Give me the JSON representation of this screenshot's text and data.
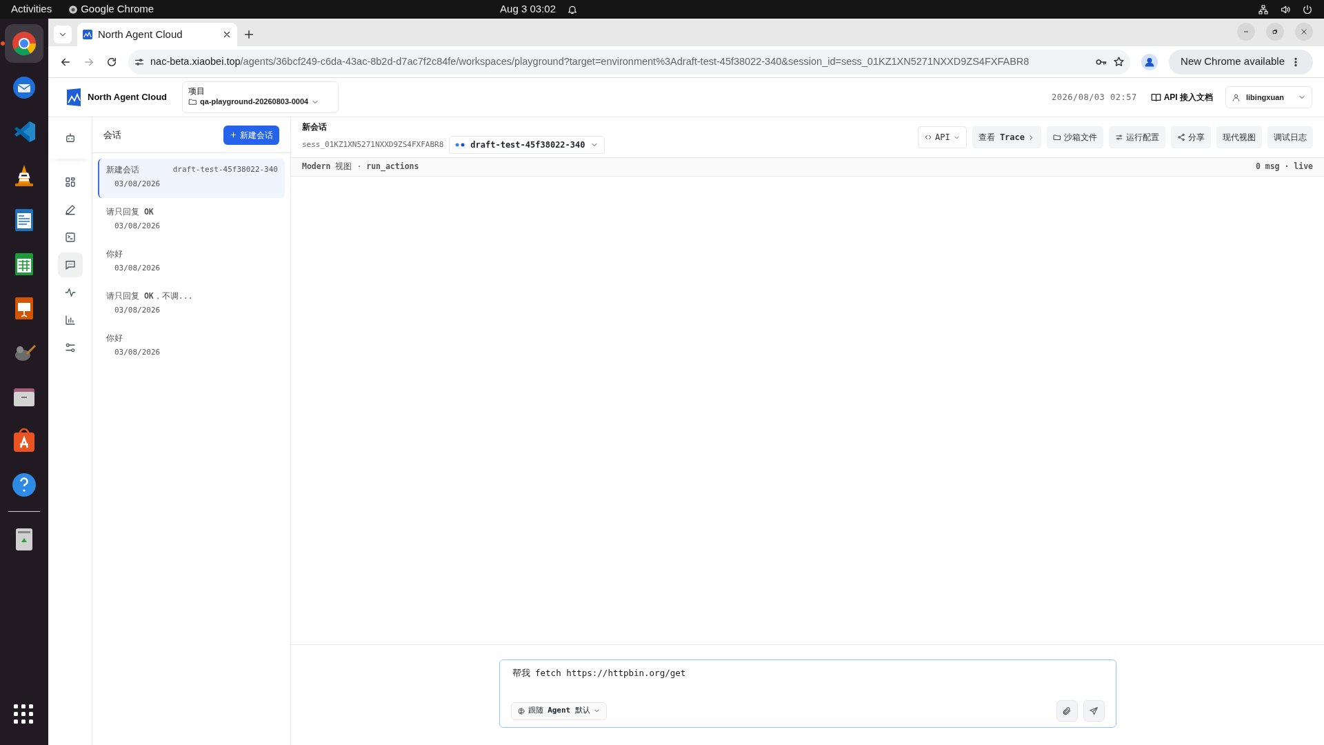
{
  "system_bar": {
    "activities": "Activities",
    "app": "Google Chrome",
    "clock": "Aug 3  03:02"
  },
  "dock": [
    {
      "kind": "chrome",
      "selected": true
    },
    {
      "kind": "mail",
      "selected": false
    },
    {
      "kind": "code",
      "selected": false
    },
    {
      "kind": "cone",
      "selected": false
    },
    {
      "kind": "writer",
      "selected": false
    },
    {
      "kind": "calc",
      "selected": false
    },
    {
      "kind": "impress",
      "selected": false
    },
    {
      "kind": "paint",
      "selected": false
    },
    {
      "kind": "files",
      "selected": false
    },
    {
      "kind": "store",
      "selected": false
    },
    {
      "kind": "help",
      "selected": false
    },
    {
      "kind": "trash",
      "selected": false
    }
  ],
  "browser": {
    "tab_title": "North Agent Cloud",
    "url_host": "nac-beta.xiaobei.top",
    "url_path": "/agents/36bcf249-c6da-43ac-8b2d-d7ac7f2c84fe/workspaces/playground?target=environment%3Adraft-test-45f38022-340&session_id=sess_01KZ1XN5271NXXD9ZS4FXFABR8",
    "update_button": "New Chrome available"
  },
  "header": {
    "brand": "North Agent Cloud",
    "project_label": "项目",
    "project": "qa-playground-20260803-0004",
    "datetime": "2026/08/03 02:57",
    "docs_link": "API 接入文档",
    "user": "libingxuan"
  },
  "rail": [
    {
      "kind": "robot",
      "selected": false
    },
    {
      "kind": "grid",
      "selected": false
    },
    {
      "kind": "pen",
      "selected": false
    },
    {
      "kind": "terminal",
      "selected": false
    },
    {
      "kind": "chat",
      "selected": true
    },
    {
      "kind": "pulse",
      "selected": false
    },
    {
      "kind": "chart",
      "selected": false
    },
    {
      "kind": "sliders",
      "selected": false
    }
  ],
  "sessions": {
    "title": "会话",
    "new_button": "新建会话",
    "items": [
      {
        "title": "新建会话",
        "tag": "draft-test-45f38022-340",
        "date": "03/08/2026",
        "selected": true
      },
      {
        "title": "请只回复 **OK**",
        "date": "03/08/2026",
        "selected": false
      },
      {
        "title": "你好",
        "date": "03/08/2026",
        "selected": false
      },
      {
        "title": "请只回复 **OK**，不调...",
        "date": "03/08/2026",
        "selected": false
      },
      {
        "title": "你好",
        "date": "03/08/2026",
        "selected": false
      }
    ]
  },
  "main": {
    "title": "新会话",
    "session_id": "sess_01KZ1XN5271NXXD9ZS4FXFABR8",
    "environment": "draft-test-45f38022-340",
    "toolbar": [
      {
        "label": "API",
        "kind": "dropdown"
      },
      {
        "label": "查看 **Trace**",
        "kind": "link"
      },
      {
        "label": "沙箱文件",
        "kind": "plain"
      },
      {
        "label": "运行配置",
        "kind": "plain"
      },
      {
        "label": "分享",
        "kind": "plain"
      },
      {
        "label": "现代视图",
        "kind": "plain"
      },
      {
        "label": "调试日志",
        "kind": "plain"
      }
    ],
    "view_info": "**Modern** 视图 · **run_actions**",
    "stats": "0 msg · live"
  },
  "composer": {
    "value": "帮我 fetch https://httpbin.org/get",
    "mode": "跟随 **Agent** 默认"
  }
}
